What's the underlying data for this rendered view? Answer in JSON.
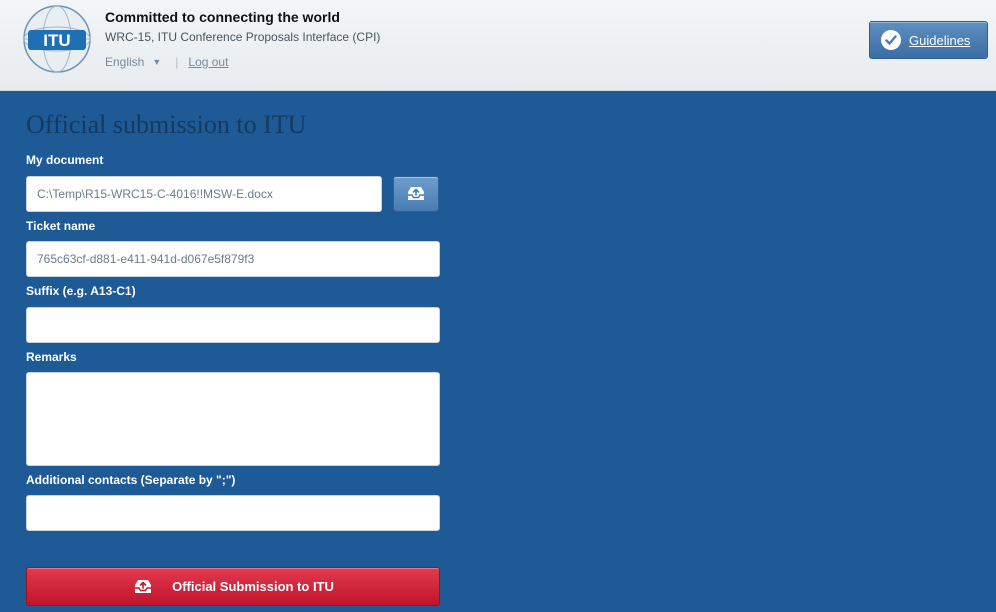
{
  "header": {
    "logo_text": "ITU",
    "tagline": "Committed to connecting the world",
    "subtitle": "WRC-15, ITU Conference Proposals Interface (CPI)",
    "language": "English",
    "logout_label": "Log out",
    "guidelines_label": "Guidelines"
  },
  "form": {
    "title": "Official submission to ITU",
    "document_label": "My document",
    "document_value": "C:\\Temp\\R15-WRC15-C-4016!!MSW-E.docx",
    "ticket_label": "Ticket name",
    "ticket_value": "765c63cf-d881-e411-941d-d067e5f879f3",
    "suffix_label": "Suffix (e.g. A13-C1)",
    "suffix_value": "",
    "remarks_label": "Remarks",
    "remarks_value": "",
    "contacts_label": "Additional contacts (Separate by \";\")",
    "contacts_value": "",
    "submit_label": "Official Submission to ITU"
  },
  "icons": {
    "guidelines": "check-circle-icon",
    "upload": "upload-tray-icon",
    "submit": "upload-tray-icon"
  },
  "colors": {
    "header_bg": "#eef1f4",
    "page_bg": "#1e5a96",
    "title": "#16395f",
    "submit": "#d0243b",
    "guidelines": "#4a7fb5"
  }
}
